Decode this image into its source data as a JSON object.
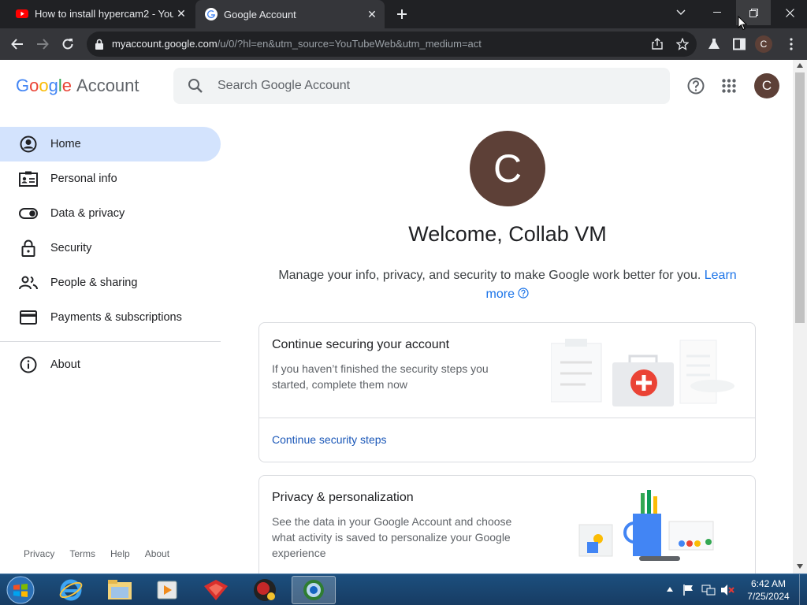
{
  "browser": {
    "tabs": [
      {
        "title": "How to install hypercam2 - YouT",
        "active": false
      },
      {
        "title": "Google Account",
        "active": true
      }
    ],
    "url_host": "myaccount.google.com",
    "url_path": "/u/0/?hl=en&utm_source=YouTubeWeb&utm_medium=act",
    "profile_initial": "C"
  },
  "header": {
    "logo_google": [
      "G",
      "o",
      "o",
      "g",
      "l",
      "e"
    ],
    "logo_account": "Account",
    "search_placeholder": "Search Google Account",
    "avatar_initial": "C"
  },
  "sidebar": {
    "items": [
      {
        "label": "Home",
        "icon": "account-circle-icon",
        "active": true
      },
      {
        "label": "Personal info",
        "icon": "id-card-icon"
      },
      {
        "label": "Data & privacy",
        "icon": "toggle-icon"
      },
      {
        "label": "Security",
        "icon": "lock-icon"
      },
      {
        "label": "People & sharing",
        "icon": "people-icon"
      },
      {
        "label": "Payments & subscriptions",
        "icon": "credit-card-icon"
      },
      {
        "label": "About",
        "icon": "info-icon"
      }
    ],
    "footer": [
      "Privacy",
      "Terms",
      "Help",
      "About"
    ]
  },
  "main": {
    "avatar_initial": "C",
    "welcome": "Welcome, Collab VM",
    "subtitle": "Manage your info, privacy, and security to make Google work better for you.",
    "learn_more_1": "Learn",
    "learn_more_2": "more",
    "cards": [
      {
        "title": "Continue securing your account",
        "body": "If you haven’t finished the security steps you started, complete them now",
        "action": "Continue security steps"
      },
      {
        "title": "Privacy & personalization",
        "body": "See the data in your Google Account and choose what activity is saved to personalize your Google experience"
      }
    ]
  },
  "taskbar": {
    "time": "6:42 AM",
    "date": "7/25/2024"
  },
  "colors": {
    "accent": "#1a73e8",
    "avatar": "#5d4037",
    "nav_active": "#d3e3fd"
  }
}
